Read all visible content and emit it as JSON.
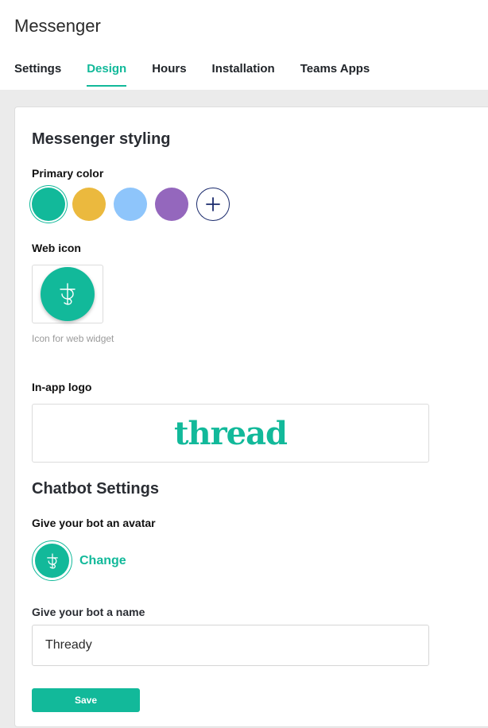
{
  "app": {
    "title": "Messenger"
  },
  "tabs": [
    {
      "label": "Settings",
      "active": false
    },
    {
      "label": "Design",
      "active": true
    },
    {
      "label": "Hours",
      "active": false
    },
    {
      "label": "Installation",
      "active": false
    },
    {
      "label": "Teams Apps",
      "active": false
    }
  ],
  "styling": {
    "title": "Messenger styling",
    "primary_color_label": "Primary color",
    "colors": [
      "#12b99a",
      "#ebb93e",
      "#8ec5fb",
      "#9467bd"
    ],
    "selected_color": "#12b99a",
    "web_icon_label": "Web icon",
    "web_icon_hint": "Icon for web widget",
    "in_app_logo_label": "In-app logo",
    "logo_text": "thread"
  },
  "chatbot": {
    "title": "Chatbot Settings",
    "avatar_label": "Give your bot an avatar",
    "change_label": "Change",
    "name_label": "Give your bot a name",
    "name_value": "Thready"
  },
  "actions": {
    "save_label": "Save"
  },
  "theme": {
    "accent": "#12b99a",
    "add_border": "#1a2a6c"
  }
}
